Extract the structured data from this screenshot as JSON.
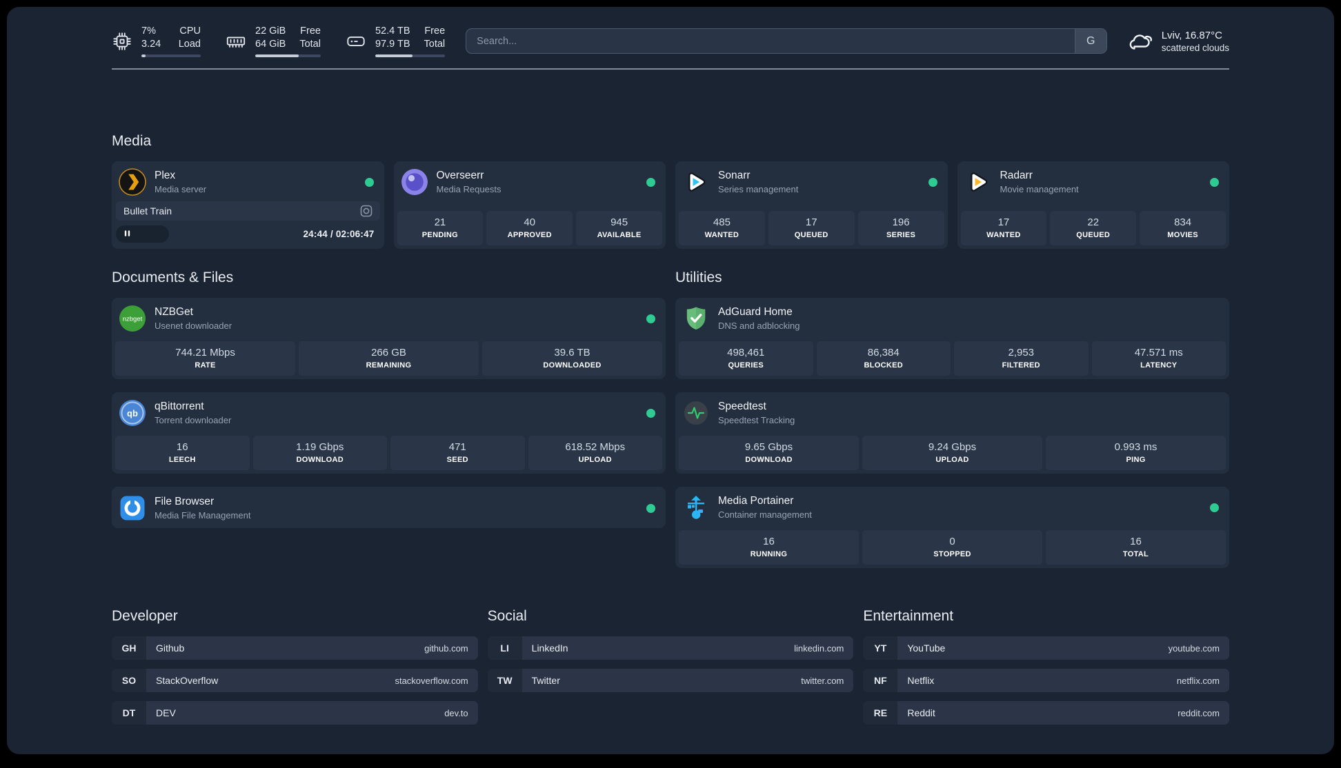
{
  "colors": {
    "page_bg": "#1b2433",
    "card_bg": "#232e3f",
    "tile_bg": "#2a3648",
    "status_green": "#2ecc92"
  },
  "header": {
    "stats": [
      {
        "icon": "cpu-icon",
        "value_top": "7%",
        "value_bottom": "3.24",
        "label_top": "CPU",
        "label_bottom": "Load",
        "progress": 7
      },
      {
        "icon": "ram-icon",
        "value_top": "22 GiB",
        "value_bottom": "64 GiB",
        "label_top": "Free",
        "label_bottom": "Total",
        "progress": 66
      },
      {
        "icon": "disk-icon",
        "value_top": "52.4 TB",
        "value_bottom": "97.9 TB",
        "label_top": "Free",
        "label_bottom": "Total",
        "progress": 53
      }
    ],
    "search": {
      "placeholder": "Search...",
      "button_label": "G"
    },
    "weather": {
      "icon": "clouds-icon",
      "location_line": "Lviv, 16.87°C",
      "condition": "scattered clouds"
    }
  },
  "sections": {
    "media": {
      "title": "Media",
      "services": [
        {
          "name": "Plex",
          "description": "Media server",
          "icon": "plex-icon",
          "online": true,
          "now_playing": {
            "title": "Bullet Train",
            "time_display": "24:44 / 02:06:47",
            "progress_percent": 20
          }
        },
        {
          "name": "Overseerr",
          "description": "Media Requests",
          "icon": "overseerr-icon",
          "online": true,
          "stats": [
            {
              "value": "21",
              "label": "PENDING"
            },
            {
              "value": "40",
              "label": "APPROVED"
            },
            {
              "value": "945",
              "label": "AVAILABLE"
            }
          ]
        },
        {
          "name": "Sonarr",
          "description": "Series management",
          "icon": "sonarr-icon",
          "online": true,
          "stats": [
            {
              "value": "485",
              "label": "WANTED"
            },
            {
              "value": "17",
              "label": "QUEUED"
            },
            {
              "value": "196",
              "label": "SERIES"
            }
          ]
        },
        {
          "name": "Radarr",
          "description": "Movie management",
          "icon": "radarr-icon",
          "online": true,
          "stats": [
            {
              "value": "17",
              "label": "WANTED"
            },
            {
              "value": "22",
              "label": "QUEUED"
            },
            {
              "value": "834",
              "label": "MOVIES"
            }
          ]
        }
      ]
    },
    "documents": {
      "title": "Documents & Files",
      "services": [
        {
          "name": "NZBGet",
          "description": "Usenet downloader",
          "icon": "nzbget-icon",
          "online": true,
          "stats": [
            {
              "value": "744.21 Mbps",
              "label": "RATE"
            },
            {
              "value": "266 GB",
              "label": "REMAINING"
            },
            {
              "value": "39.6 TB",
              "label": "DOWNLOADED"
            }
          ]
        },
        {
          "name": "qBittorrent",
          "description": "Torrent downloader",
          "icon": "qbittorrent-icon",
          "online": true,
          "stats": [
            {
              "value": "16",
              "label": "LEECH"
            },
            {
              "value": "1.19 Gbps",
              "label": "DOWNLOAD"
            },
            {
              "value": "471",
              "label": "SEED"
            },
            {
              "value": "618.52 Mbps",
              "label": "UPLOAD"
            }
          ]
        },
        {
          "name": "File Browser",
          "description": "Media File Management",
          "icon": "filebrowser-icon",
          "online": true,
          "stats": []
        }
      ]
    },
    "utilities": {
      "title": "Utilities",
      "services": [
        {
          "name": "AdGuard Home",
          "description": "DNS and adblocking",
          "icon": "adguard-icon",
          "online": false,
          "stats": [
            {
              "value": "498,461",
              "label": "QUERIES"
            },
            {
              "value": "86,384",
              "label": "BLOCKED"
            },
            {
              "value": "2,953",
              "label": "FILTERED"
            },
            {
              "value": "47.571 ms",
              "label": "LATENCY"
            }
          ]
        },
        {
          "name": "Speedtest",
          "description": "Speedtest Tracking",
          "icon": "speedtest-icon",
          "online": false,
          "stats": [
            {
              "value": "9.65 Gbps",
              "label": "DOWNLOAD"
            },
            {
              "value": "9.24 Gbps",
              "label": "UPLOAD"
            },
            {
              "value": "0.993 ms",
              "label": "PING"
            }
          ]
        },
        {
          "name": "Media Portainer",
          "description": "Container management",
          "icon": "portainer-icon",
          "online": true,
          "stats": [
            {
              "value": "16",
              "label": "RUNNING"
            },
            {
              "value": "0",
              "label": "STOPPED"
            },
            {
              "value": "16",
              "label": "TOTAL"
            }
          ]
        }
      ]
    }
  },
  "bookmarks": [
    {
      "title": "Developer",
      "links": [
        {
          "abbr": "GH",
          "label": "Github",
          "url": "github.com"
        },
        {
          "abbr": "SO",
          "label": "StackOverflow",
          "url": "stackoverflow.com"
        },
        {
          "abbr": "DT",
          "label": "DEV",
          "url": "dev.to"
        }
      ]
    },
    {
      "title": "Social",
      "links": [
        {
          "abbr": "LI",
          "label": "LinkedIn",
          "url": "linkedin.com"
        },
        {
          "abbr": "TW",
          "label": "Twitter",
          "url": "twitter.com"
        }
      ]
    },
    {
      "title": "Entertainment",
      "links": [
        {
          "abbr": "YT",
          "label": "YouTube",
          "url": "youtube.com"
        },
        {
          "abbr": "NF",
          "label": "Netflix",
          "url": "netflix.com"
        },
        {
          "abbr": "RE",
          "label": "Reddit",
          "url": "reddit.com"
        }
      ]
    }
  ]
}
